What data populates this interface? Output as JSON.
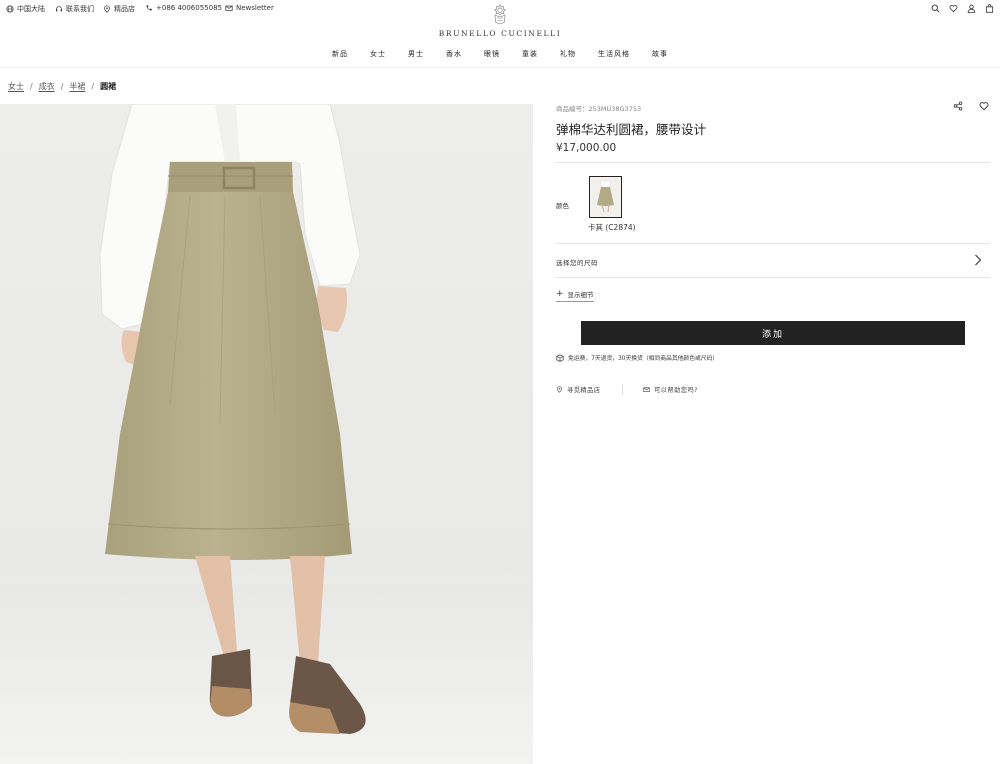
{
  "topbar": {
    "region": "中国大陆",
    "contact": "联系我们",
    "stores": "精品店",
    "phone": "+086 4006055085",
    "newsletter": "Newsletter"
  },
  "brand": {
    "name": "BRUNELLO CUCINELLI"
  },
  "nav": {
    "items": [
      "新品",
      "女士",
      "男士",
      "香水",
      "眼镜",
      "童装",
      "礼物",
      "生活风格",
      "故事"
    ]
  },
  "breadcrumb": {
    "items": [
      "女士",
      "成衣",
      "半裙"
    ],
    "current": "圆裙"
  },
  "product": {
    "sku_label": "商品编号：253MU38G3753",
    "title": "弹棉华达利圆裙，腰带设计",
    "price": "¥17,000.00",
    "color_label": "颜色",
    "color_name": "卡其 (C2874)",
    "size_label": "选择您的尺码",
    "details_label": "显示细节",
    "add_label": "添加",
    "shipping_text": "免运费，7天退货，30天换货（相同商品其他颜色或尺码）",
    "store_link": "寻觅精品店",
    "help_link": "可以帮助您吗?"
  },
  "colors": {
    "button": "#222222",
    "skirt": "#b7ae8a",
    "background": "#ededeb"
  },
  "icons": [
    "globe-icon",
    "headset-icon",
    "pin-icon",
    "phone-icon",
    "mail-icon",
    "search-icon",
    "heart-icon",
    "user-icon",
    "bag-icon",
    "share-icon",
    "chevron-right-icon",
    "shipping-box-icon"
  ]
}
